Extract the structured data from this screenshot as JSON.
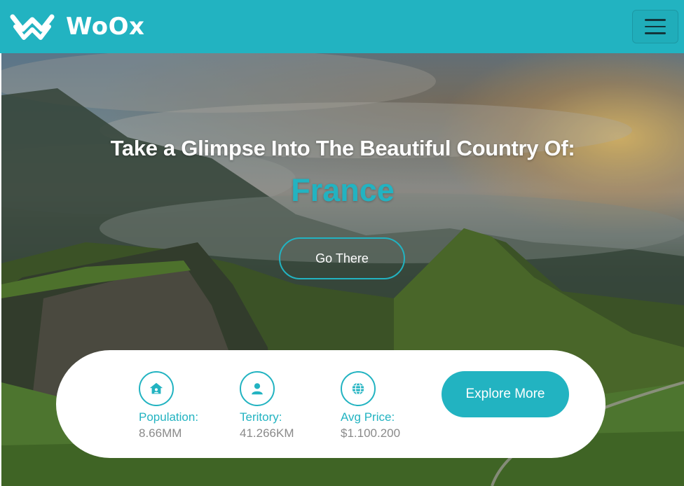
{
  "header": {
    "brand": "WoOx",
    "menu_icon": "hamburger-menu-icon",
    "logo_icon": "double-chevron-logo-icon"
  },
  "hero": {
    "headline": "Take a Glimpse Into The Beautiful Country Of:",
    "country": "France",
    "cta_label": "Go There"
  },
  "stats": [
    {
      "icon": "home-icon",
      "label": "Population:",
      "value": "8.66MM"
    },
    {
      "icon": "user-icon",
      "label": "Teritory:",
      "value": "41.266KM"
    },
    {
      "icon": "globe-icon",
      "label": "Avg Price:",
      "value": "$1.100.200"
    }
  ],
  "card": {
    "explore_label": "Explore More"
  },
  "colors": {
    "accent": "#22b3c1",
    "text_muted": "#8a8a8a",
    "white": "#ffffff"
  }
}
